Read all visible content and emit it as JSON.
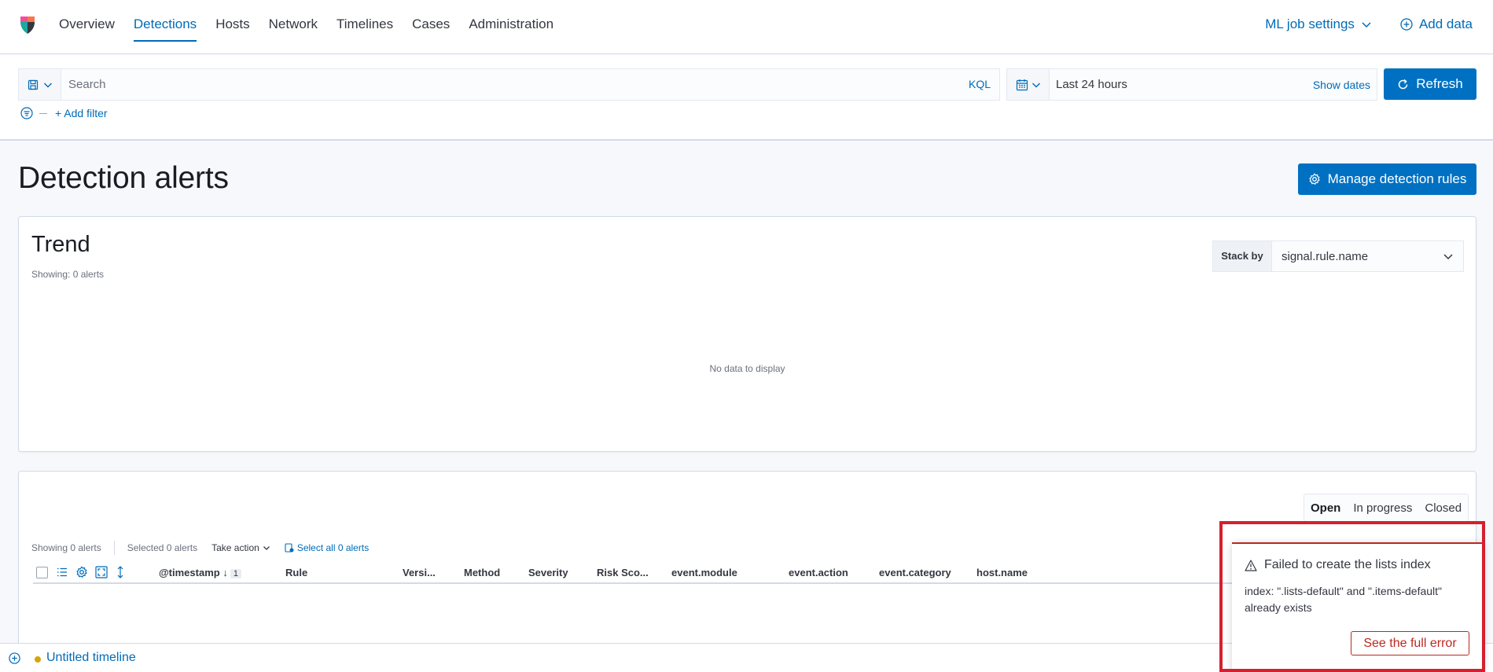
{
  "nav": {
    "tabs": [
      {
        "label": "Overview"
      },
      {
        "label": "Detections"
      },
      {
        "label": "Hosts"
      },
      {
        "label": "Network"
      },
      {
        "label": "Timelines"
      },
      {
        "label": "Cases"
      },
      {
        "label": "Administration"
      }
    ],
    "active_tab": "Detections",
    "ml_settings_label": "ML job settings",
    "add_data_label": "Add data"
  },
  "query_bar": {
    "search_placeholder": "Search",
    "language_label": "KQL",
    "date_range": "Last 24 hours",
    "show_dates_label": "Show dates",
    "refresh_label": "Refresh",
    "add_filter_label": "+ Add filter"
  },
  "page": {
    "title": "Detection alerts",
    "manage_rules_label": "Manage detection rules"
  },
  "trend": {
    "title": "Trend",
    "count_text": "Showing: 0 alerts",
    "stack_by_label": "Stack by",
    "stack_by_value": "signal.rule.name",
    "empty_text": "No data to display"
  },
  "alerts": {
    "status_tabs": [
      {
        "label": "Open",
        "active": true
      },
      {
        "label": "In progress",
        "active": false
      },
      {
        "label": "Closed",
        "active": false
      }
    ],
    "showing_text": "Showing 0 alerts",
    "selected_text": "Selected 0 alerts",
    "take_action_label": "Take action",
    "select_all_label": "Select all 0 alerts",
    "columns": {
      "timestamp": "@timestamp",
      "sort_index": "1",
      "rule": "Rule",
      "version": "Versi...",
      "method": "Method",
      "severity": "Severity",
      "risk_score": "Risk Sco...",
      "event_module": "event.module",
      "event_action": "event.action",
      "event_category": "event.category",
      "host_name": "host.name"
    }
  },
  "timeline": {
    "name": "Untitled timeline"
  },
  "toast": {
    "title": "Failed to create the lists index",
    "message": "index: \".lists-default\" and \".items-default\" already exists",
    "button_label": "See the full error"
  },
  "colors": {
    "primary": "#0071c2",
    "link": "#006bb8",
    "danger": "#bd271e",
    "highlight": "#d61f2e",
    "timeline_dot": "#d6a40b"
  },
  "icons": {
    "logo": "security-app-logo",
    "ml_settings_caret": "chevron-down-icon",
    "add_data": "plus-in-circle-icon",
    "saved_query": "save-icon",
    "calendar": "calendar-icon",
    "refresh": "refresh-icon",
    "filter": "filter-icon",
    "manage_rules": "gear-icon",
    "toast_warning": "warning-icon",
    "timeline_add": "plus-in-circle-icon"
  }
}
